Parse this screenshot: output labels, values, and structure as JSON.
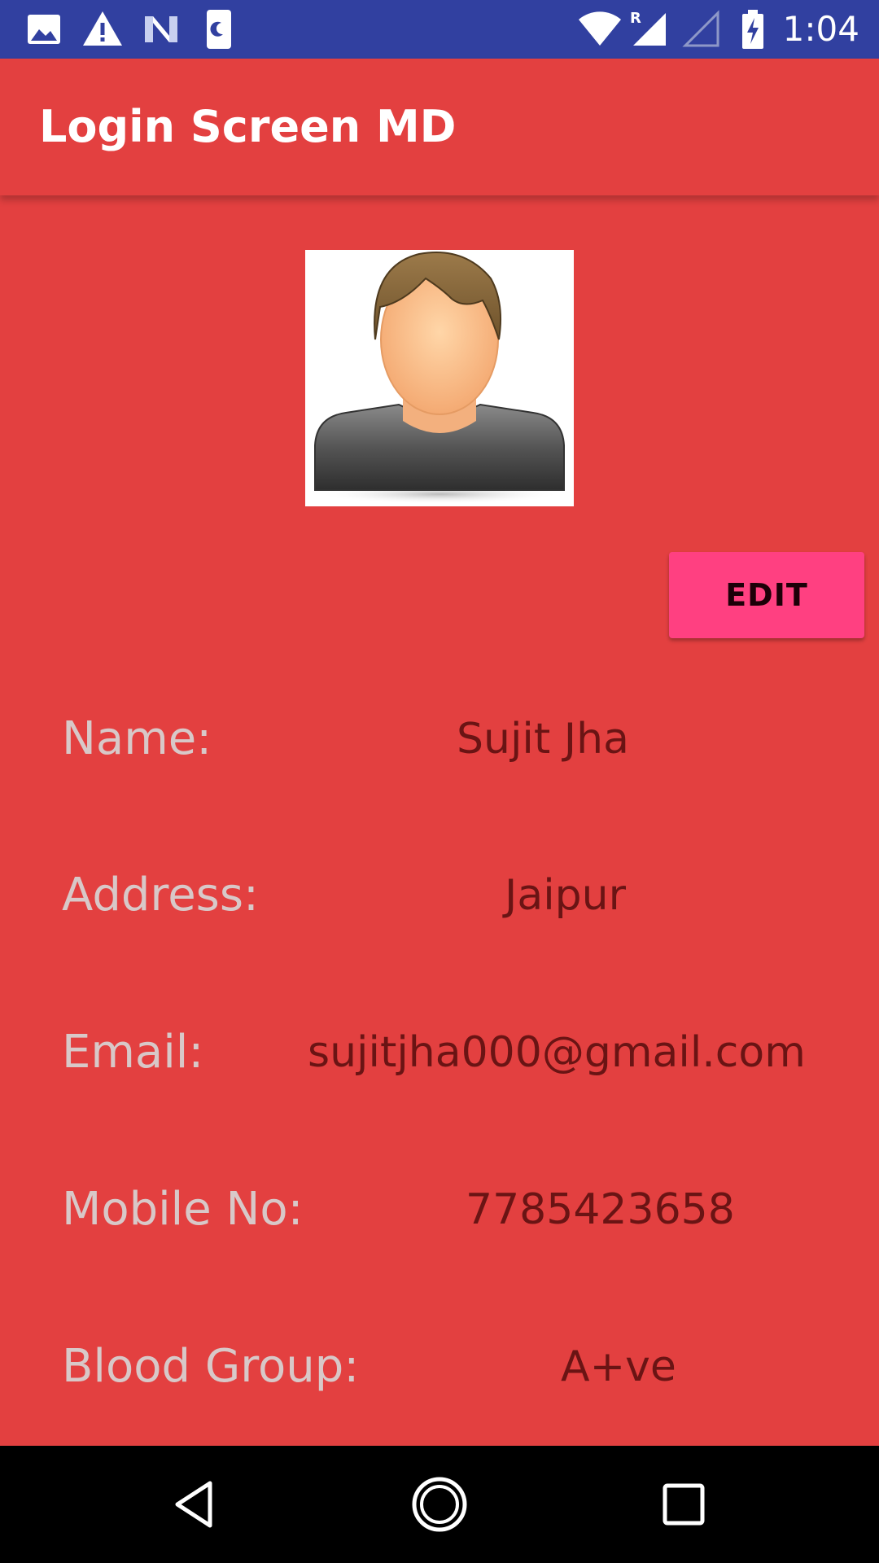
{
  "status_bar": {
    "time": "1:04",
    "icons": [
      "image-icon",
      "warning-icon",
      "n-logo-icon",
      "night-mode-icon",
      "wifi-icon",
      "signal-roaming-icon",
      "signal-empty-icon",
      "battery-charging-icon"
    ],
    "roaming_letter": "R"
  },
  "app_bar": {
    "title": "Login Screen MD"
  },
  "profile": {
    "edit_label": "EDIT",
    "fields": [
      {
        "label": "Name:",
        "value": "Sujit Jha"
      },
      {
        "label": "Address:",
        "value": "Jaipur"
      },
      {
        "label": "Email:",
        "value": "sujitjha000@gmail.com"
      },
      {
        "label": "Mobile No:",
        "value": "7785423658"
      },
      {
        "label": "Blood Group:",
        "value": "A+ve"
      }
    ]
  },
  "nav_bar": {
    "buttons": [
      "back-icon",
      "home-icon",
      "recents-icon"
    ]
  },
  "colors": {
    "status_bar": "#3140a0",
    "background": "#e34040",
    "accent": "#ff4081",
    "label_text": "#d8c8c8",
    "value_text": "#6a1414"
  }
}
